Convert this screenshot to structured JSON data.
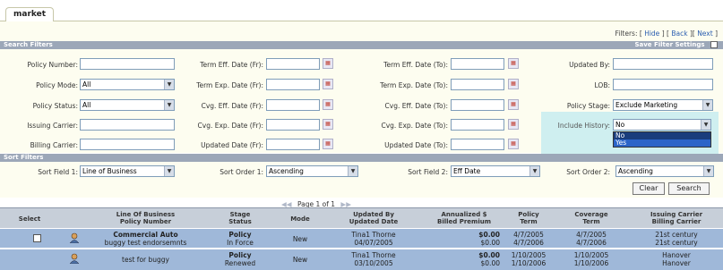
{
  "tab": {
    "label": "market"
  },
  "filters_links": {
    "prefix": "Filters: [",
    "hide": "Hide",
    "mid1": "] [",
    "back": "Back",
    "mid2": "][",
    "next": "Next",
    "suffix": "]"
  },
  "search_filters": {
    "title": "Search Filters",
    "save_label": "Save Filter Settings",
    "fields": {
      "policy_number": {
        "label": "Policy Number:",
        "value": ""
      },
      "policy_mode": {
        "label": "Policy Mode:",
        "value": "All"
      },
      "policy_status": {
        "label": "Policy Status:",
        "value": "All"
      },
      "issuing_carrier": {
        "label": "Issuing Carrier:",
        "value": ""
      },
      "billing_carrier": {
        "label": "Billing Carrier:",
        "value": ""
      },
      "term_eff_fr": {
        "label": "Term Eff. Date (Fr):",
        "value": ""
      },
      "term_exp_fr": {
        "label": "Term Exp. Date (Fr):",
        "value": ""
      },
      "cvg_eff_fr": {
        "label": "Cvg. Eff. Date (Fr):",
        "value": ""
      },
      "cvg_exp_fr": {
        "label": "Cvg. Exp. Date (Fr):",
        "value": ""
      },
      "updated_fr": {
        "label": "Updated Date (Fr):",
        "value": ""
      },
      "term_eff_to": {
        "label": "Term Eff. Date (To):",
        "value": ""
      },
      "term_exp_to": {
        "label": "Term Exp. Date (To):",
        "value": ""
      },
      "cvg_eff_to": {
        "label": "Cvg. Eff. Date (To):",
        "value": ""
      },
      "cvg_exp_to": {
        "label": "Cvg. Exp. Date (To):",
        "value": ""
      },
      "updated_to": {
        "label": "Updated Date (To):",
        "value": ""
      },
      "updated_by": {
        "label": "Updated By:",
        "value": ""
      },
      "lob": {
        "label": "LOB:",
        "value": ""
      },
      "policy_stage": {
        "label": "Policy Stage:",
        "value": "Exclude Marketing"
      },
      "include_history": {
        "label": "Include History:",
        "value": "No",
        "options": [
          "No",
          "Yes"
        ]
      }
    }
  },
  "sort_filters": {
    "title": "Sort Filters",
    "field1": {
      "label": "Sort Field 1:",
      "value": "Line of Business"
    },
    "order1": {
      "label": "Sort Order 1:",
      "value": "Ascending"
    },
    "field2": {
      "label": "Sort Field 2:",
      "value": "Eff Date"
    },
    "order2": {
      "label": "Sort Order 2:",
      "value": "Ascending"
    },
    "clear_label": "Clear",
    "search_label": "Search"
  },
  "pager": {
    "text": "Page 1 of 1"
  },
  "table": {
    "headers": {
      "select": "Select",
      "lob_1": "Line Of Business",
      "lob_2": "Policy Number",
      "stage_1": "Stage",
      "stage_2": "Status",
      "mode": "Mode",
      "updby_1": "Updated By",
      "updby_2": "Updated Date",
      "prem_1": "Annualized $",
      "prem_2": "Billed Premium",
      "pterm_1": "Policy",
      "pterm_2": "Term",
      "cterm_1": "Coverage",
      "cterm_2": "Term",
      "carrier_1": "Issuing Carrier",
      "carrier_2": "Billing Carrier"
    },
    "rows": [
      {
        "lob": "Commercial Auto",
        "policy": "buggy test endorsemnts",
        "stage": "Policy",
        "status": "In Force",
        "mode": "New",
        "updby": "Tina1 Thorne",
        "upddate": "04/07/2005",
        "annual": "$0.00",
        "billed": "$0.00",
        "pterm1": "4/7/2005",
        "pterm2": "4/7/2006",
        "cterm1": "4/7/2005",
        "cterm2": "4/7/2006",
        "icarrier": "21st century",
        "bcarrier": "21st century"
      },
      {
        "lob": "",
        "policy": "test for buggy",
        "stage": "Policy",
        "status": "Renewed",
        "mode": "New",
        "updby": "Tina1 Thorne",
        "upddate": "03/10/2005",
        "annual": "$0.00",
        "billed": "$0.00",
        "pterm1": "1/10/2005",
        "pterm2": "1/10/2006",
        "cterm1": "1/10/2005",
        "cterm2": "1/10/2006",
        "icarrier": "Hanover",
        "bcarrier": "Hanover"
      }
    ]
  }
}
